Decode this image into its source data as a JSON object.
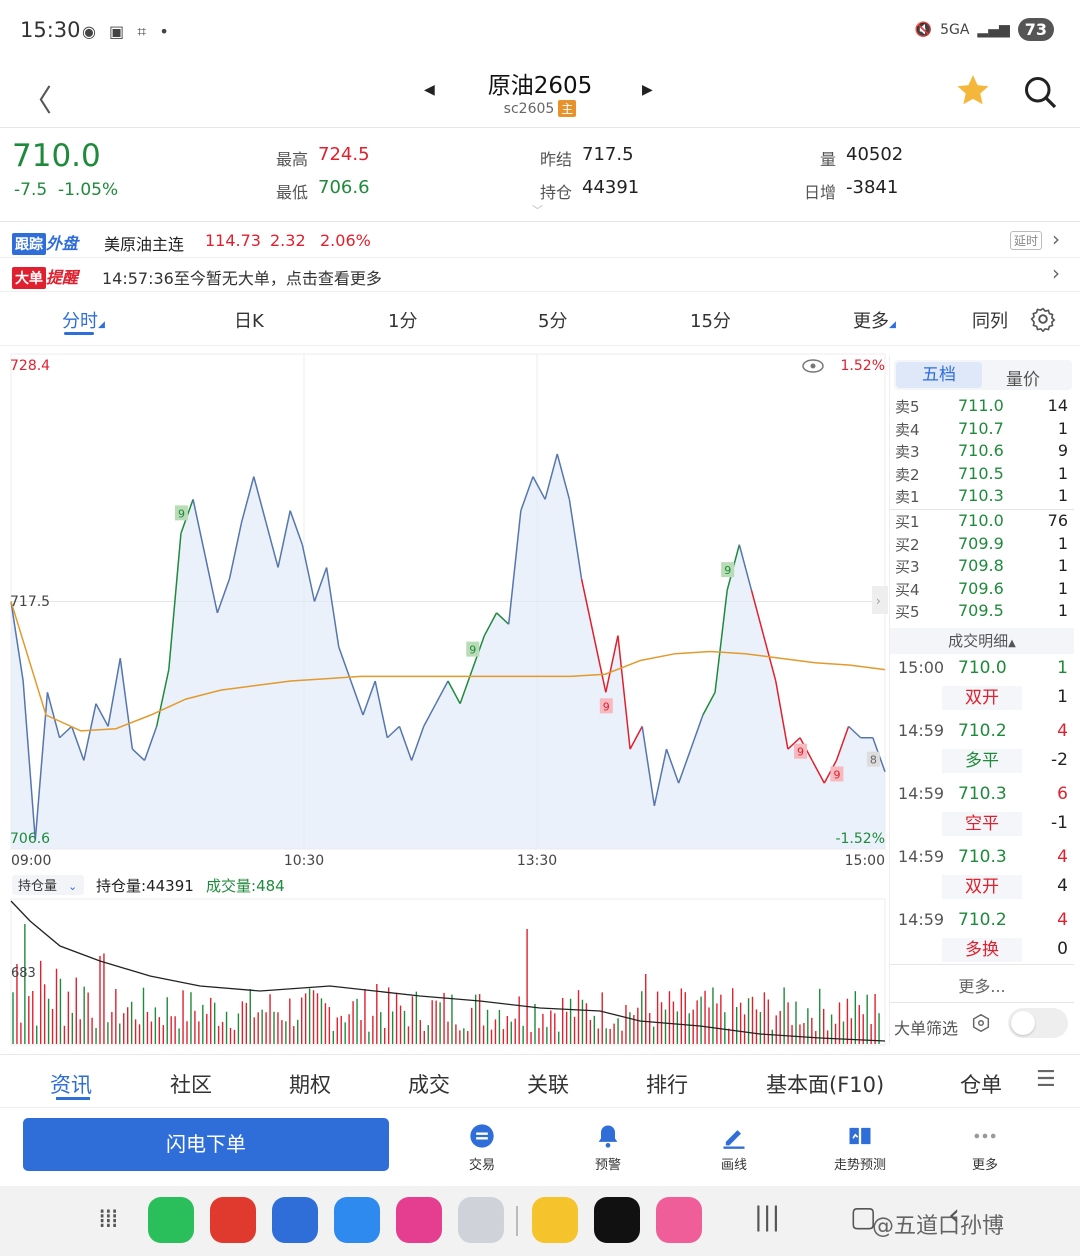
{
  "status_bar": {
    "time": "15:30",
    "battery": "73",
    "network": "5GA"
  },
  "header": {
    "title": "原油2605",
    "code": "sc2605",
    "main_badge": "主"
  },
  "quote": {
    "last": "710.0",
    "change": "-7.5",
    "change_pct": "-1.05%",
    "high_label": "最高",
    "high": "724.5",
    "low_label": "最低",
    "low": "706.6",
    "prev_settle_label": "昨结",
    "prev_settle": "717.5",
    "oi_label": "持仓",
    "oi": "44391",
    "volume_label": "量",
    "volume": "40502",
    "day_inc_label": "日增",
    "day_inc": "-3841"
  },
  "track": {
    "tag1": "跟踪",
    "tag2": "外盘",
    "name": "美原油主连",
    "price": "114.73",
    "chg": "2.32",
    "pct": "2.06%",
    "delay": "延时"
  },
  "alert": {
    "tag1": "大单",
    "tag2": "提醒",
    "text": "14:57:36至今暂无大单，点击查看更多"
  },
  "period_tabs": [
    "分时",
    "日K",
    "1分",
    "5分",
    "15分",
    "更多",
    "同列"
  ],
  "chart": {
    "y_top": "728.4",
    "y_mid": "717.5",
    "y_bot": "706.6",
    "pct_top": "1.52%",
    "pct_bot": "-1.52%",
    "x_labels": [
      "09:00",
      "10:30",
      "13:30",
      "15:00"
    ]
  },
  "chart_data": {
    "type": "line",
    "title": "",
    "ylim": [
      706.6,
      728.4
    ],
    "x_ticks": [
      "09:00",
      "10:30",
      "13:30",
      "15:00"
    ],
    "series": [
      {
        "name": "price",
        "values": [
          717.5,
          714.0,
          707.0,
          713.5,
          711.5,
          712.0,
          710.5,
          713.0,
          712.0,
          715.0,
          711.0,
          710.5,
          712.0,
          714.5,
          720.5,
          722.0,
          719.5,
          717.0,
          718.5,
          721.0,
          723.0,
          721.0,
          719.0,
          721.5,
          720.0,
          717.5,
          719.0,
          715.5,
          714.0,
          712.5,
          714.0,
          711.5,
          712.0,
          710.5,
          712.0,
          713.0,
          714.0,
          713.0,
          714.5,
          716.0,
          717.0,
          716.5,
          721.5,
          723.0,
          722.0,
          724.0,
          722.0,
          718.5,
          716.0,
          713.5,
          716.0,
          711.0,
          712.0,
          708.5,
          711.0,
          709.5,
          711.0,
          712.5,
          713.5,
          718.0,
          720.0,
          718.0,
          716.0,
          714.0,
          711.0,
          711.5,
          710.5,
          709.5,
          710.5,
          712.0,
          711.5,
          711.5,
          710.0
        ]
      },
      {
        "name": "avg",
        "values": [
          717.5,
          712.5,
          711.8,
          711.9,
          712.5,
          713.2,
          713.6,
          713.8,
          714.0,
          714.1,
          714.2,
          714.2,
          714.2,
          714.2,
          714.2,
          714.2,
          714.2,
          714.3,
          714.9,
          715.2,
          715.3,
          715.2,
          715.0,
          714.8,
          714.7,
          714.5
        ]
      }
    ],
    "open_interest": {
      "label": "持仓量",
      "value": "44391",
      "volume_label": "成交量",
      "volume_value": "484",
      "scale_label": "683"
    }
  },
  "order_book": {
    "tabs": [
      "五档",
      "量价"
    ],
    "asks": [
      {
        "label": "卖5",
        "price": "711.0",
        "qty": "14"
      },
      {
        "label": "卖4",
        "price": "710.7",
        "qty": "1"
      },
      {
        "label": "卖3",
        "price": "710.6",
        "qty": "9"
      },
      {
        "label": "卖2",
        "price": "710.5",
        "qty": "1"
      },
      {
        "label": "卖1",
        "price": "710.3",
        "qty": "1"
      }
    ],
    "bids": [
      {
        "label": "买1",
        "price": "710.0",
        "qty": "76"
      },
      {
        "label": "买2",
        "price": "709.9",
        "qty": "1"
      },
      {
        "label": "买3",
        "price": "709.8",
        "qty": "1"
      },
      {
        "label": "买4",
        "price": "709.6",
        "qty": "1"
      },
      {
        "label": "买5",
        "price": "709.5",
        "qty": "1"
      }
    ],
    "trades_header": "成交明细",
    "trades": [
      {
        "time": "15:00",
        "price": "710.0",
        "qty": "1",
        "type": "双开",
        "type2": "1"
      },
      {
        "time": "14:59",
        "price": "710.2",
        "qty": "4",
        "type": "多平",
        "type2": "-2"
      },
      {
        "time": "14:59",
        "price": "710.3",
        "qty": "6",
        "type": "空平",
        "type2": "-1"
      },
      {
        "time": "14:59",
        "price": "710.3",
        "qty": "4",
        "type": "双开",
        "type2": "4"
      },
      {
        "time": "14:59",
        "price": "710.2",
        "qty": "4",
        "type": "多换",
        "type2": "0"
      }
    ],
    "more": "更多...",
    "filter": "大单筛选"
  },
  "bottom_tabs": [
    "资讯",
    "社区",
    "期权",
    "成交",
    "关联",
    "排行",
    "基本面(F10)",
    "仓单"
  ],
  "actions": {
    "flash_order": "闪电下单",
    "items": [
      "交易",
      "预警",
      "画线",
      "走势预测",
      "更多"
    ]
  },
  "watermark": "@五道口孙博"
}
